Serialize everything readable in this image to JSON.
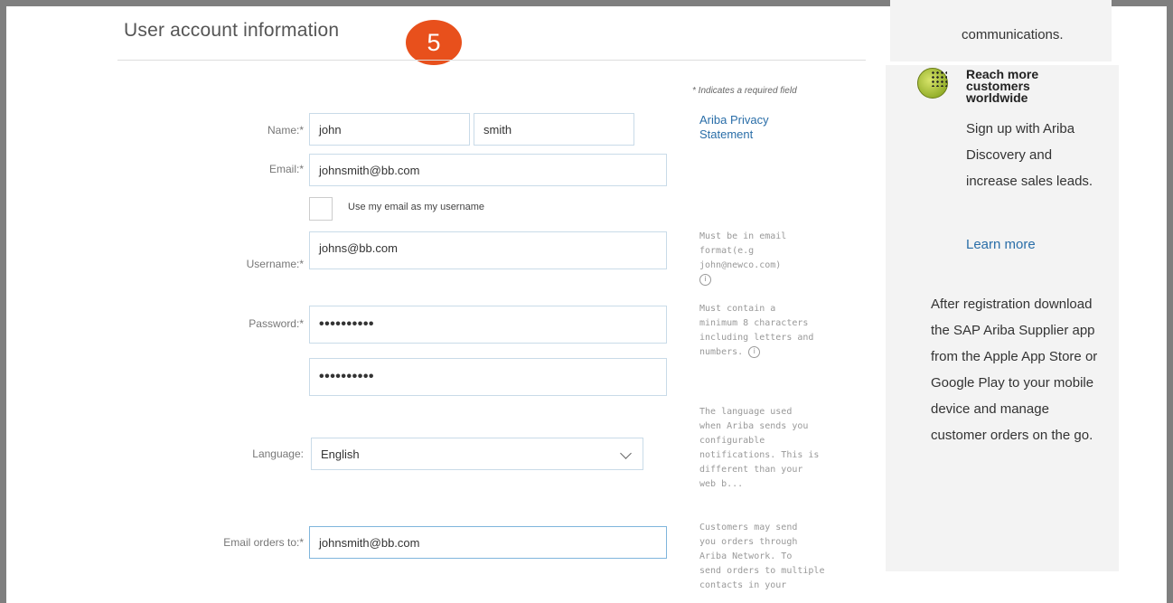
{
  "header": {
    "title": "User account information",
    "step_number": "5"
  },
  "colors": {
    "step_badge": "#e8501c",
    "link": "#2a6ea8",
    "frame": "#7f7f7f"
  },
  "form": {
    "required_note": "* Indicates a required field",
    "privacy_link": "Ariba Privacy Statement",
    "name": {
      "label": "Name:*",
      "first": "john",
      "last": "smith"
    },
    "email": {
      "label": "Email:*",
      "value": "johnsmith@bb.com"
    },
    "use_email_checkbox": {
      "label": "Use my email as my username",
      "checked": false
    },
    "username": {
      "label": "Username:*",
      "value": "johns@bb.com"
    },
    "password": {
      "label": "Password:*",
      "value": "••••••••••",
      "confirm_value": "••••••••••"
    },
    "language": {
      "label": "Language:",
      "value": "English"
    },
    "email_orders": {
      "label": "Email orders to:*",
      "value": "johnsmith@bb.com"
    }
  },
  "hints": {
    "username_hint": [
      "Must be in email",
      "format(e.g",
      "john@newco.com)"
    ],
    "password_hint": [
      "Must contain a",
      "minimum 8 characters",
      "including letters and",
      "numbers."
    ],
    "language_hint": [
      "The language used",
      "when Ariba sends you",
      "configurable",
      "notifications. This is",
      "different than your",
      "web b..."
    ],
    "orders_hint": [
      "Customers may send",
      "you orders through",
      "Ariba Network. To",
      "send orders to multiple",
      "contacts in your"
    ]
  },
  "sidebar": {
    "top_text": "communications.",
    "promo_title": "Reach more customers worldwide",
    "promo_body": "Sign up with Ariba Discovery and increase sales leads.",
    "learn_more": "Learn more",
    "after_text": "After registration download the SAP Ariba Supplier app from the Apple App Store or Google Play to your mobile device and manage customer orders on the go."
  }
}
